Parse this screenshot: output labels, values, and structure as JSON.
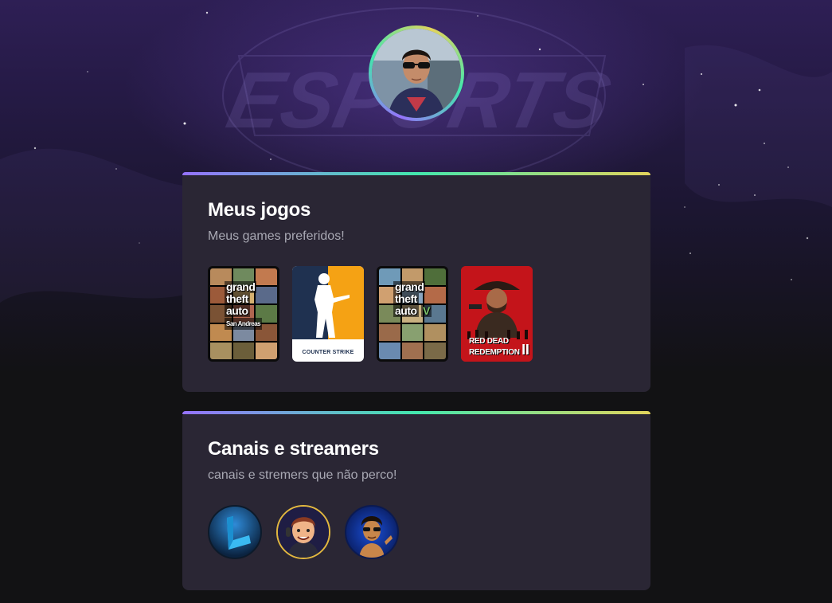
{
  "profile": {
    "avatar_alt": "Foto de perfil"
  },
  "games_section": {
    "title": "Meus jogos",
    "subtitle": "Meus games preferidos!",
    "games": [
      {
        "name": "Grand Theft Auto San Andreas",
        "logo_lines": [
          "grand",
          "theft",
          "auto",
          "San Andreas"
        ]
      },
      {
        "name": "Counter Strike",
        "logo_text": "COUNTER STRIKE"
      },
      {
        "name": "Grand Theft Auto V",
        "logo_lines": [
          "grand",
          "theft",
          "auto",
          "V"
        ]
      },
      {
        "name": "Red Dead Redemption II",
        "logo_lines": [
          "RED DEAD",
          "REDEMPTION",
          "II"
        ]
      }
    ]
  },
  "streams_section": {
    "title": "Canais e streamers",
    "subtitle": "canais e stremers que não perco!",
    "channels": [
      {
        "name": "channel-1"
      },
      {
        "name": "channel-2"
      },
      {
        "name": "channel-3"
      }
    ]
  },
  "colors": {
    "accent_purple": "#9572fc",
    "accent_green": "#43e7ad",
    "accent_yellow": "#e2d45c",
    "card_bg": "#2a2634",
    "page_bg": "#121214"
  }
}
